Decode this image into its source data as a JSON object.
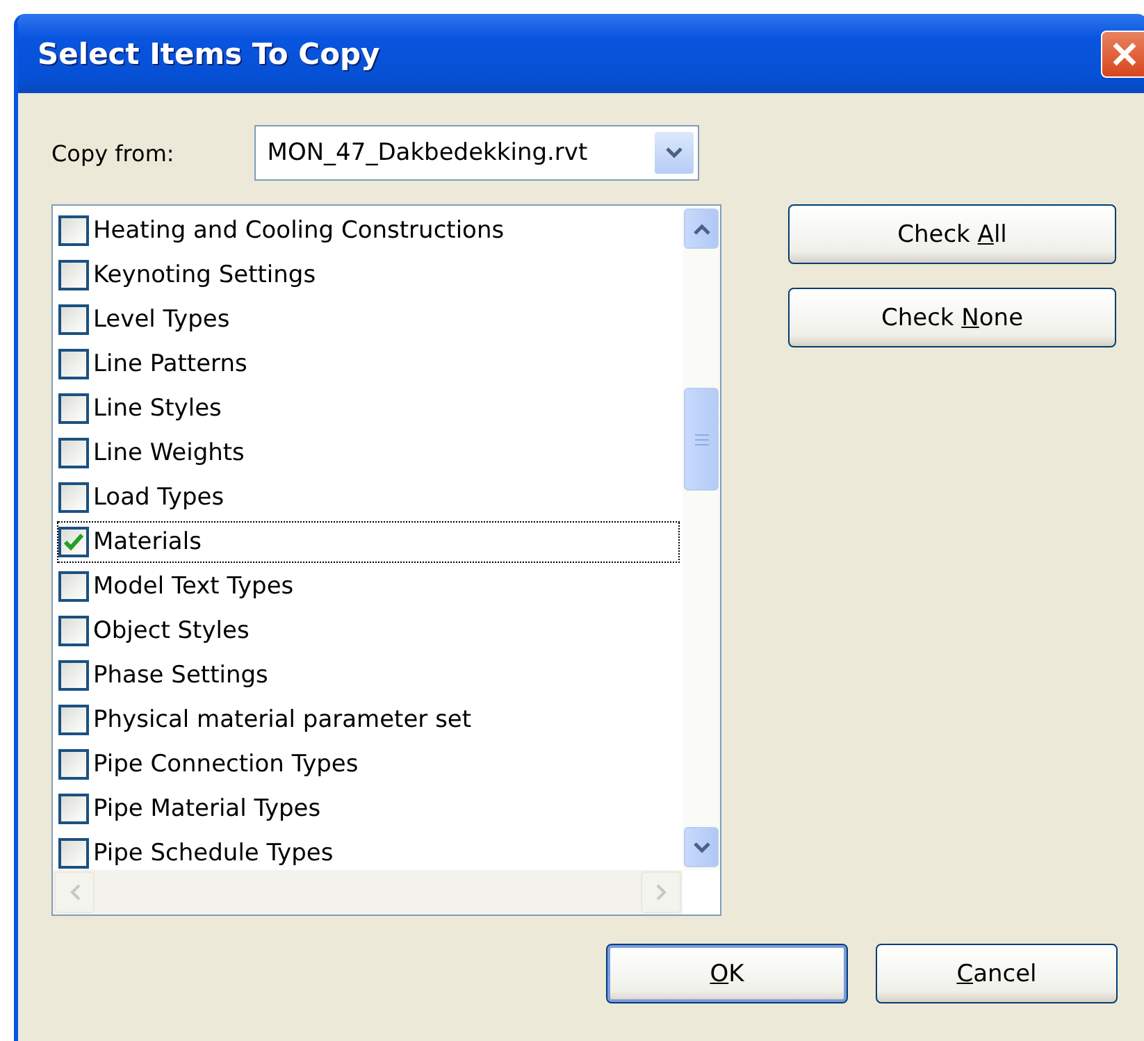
{
  "window": {
    "title": "Select Items To Copy"
  },
  "copy_from": {
    "label": "Copy from:",
    "value": "MON_47_Dakbedekking.rvt"
  },
  "items": [
    {
      "label": "Heating and Cooling Constructions",
      "checked": false,
      "selected": false
    },
    {
      "label": "Keynoting Settings",
      "checked": false,
      "selected": false
    },
    {
      "label": "Level Types",
      "checked": false,
      "selected": false
    },
    {
      "label": "Line Patterns",
      "checked": false,
      "selected": false
    },
    {
      "label": "Line Styles",
      "checked": false,
      "selected": false
    },
    {
      "label": "Line Weights",
      "checked": false,
      "selected": false
    },
    {
      "label": "Load Types",
      "checked": false,
      "selected": false
    },
    {
      "label": "Materials",
      "checked": true,
      "selected": true
    },
    {
      "label": "Model Text Types",
      "checked": false,
      "selected": false
    },
    {
      "label": "Object Styles",
      "checked": false,
      "selected": false
    },
    {
      "label": "Phase Settings",
      "checked": false,
      "selected": false
    },
    {
      "label": "Physical material parameter set",
      "checked": false,
      "selected": false
    },
    {
      "label": "Pipe Connection Types",
      "checked": false,
      "selected": false
    },
    {
      "label": "Pipe Material Types",
      "checked": false,
      "selected": false
    },
    {
      "label": "Pipe Schedule Types",
      "checked": false,
      "selected": false
    }
  ],
  "side_buttons": [
    {
      "label_before": "Check ",
      "access_key": "A",
      "label_after": "ll"
    },
    {
      "label_before": "Check ",
      "access_key": "N",
      "label_after": "one"
    }
  ],
  "footer_buttons": [
    {
      "access_key": "O",
      "label_after": "K",
      "default": true
    },
    {
      "access_key": "C",
      "label_after": "ancel",
      "default": false
    }
  ]
}
